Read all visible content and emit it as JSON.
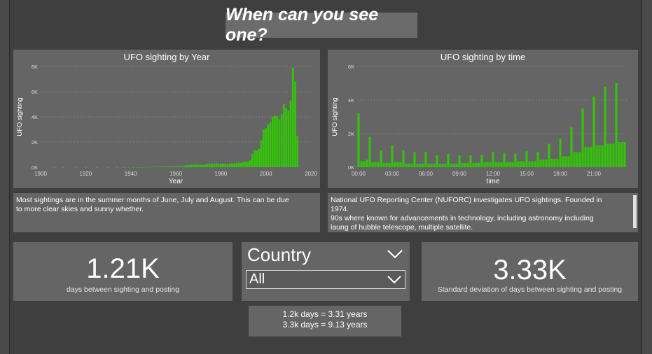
{
  "header": {
    "title": "When can you see one?"
  },
  "chart_year": {
    "title": "UFO sighting by Year",
    "xlabel": "Year",
    "ylabel": "UFO sighting",
    "x_ticks": [
      "1900",
      "1920",
      "1940",
      "1960",
      "1980",
      "2000",
      "2020"
    ],
    "y_ticks": [
      "0K",
      "2K",
      "4K",
      "6K",
      "8K"
    ]
  },
  "chart_time": {
    "title": "UFO sighting by time",
    "xlabel": "time",
    "ylabel": "UFO sighting",
    "x_ticks": [
      "00:00",
      "03:00",
      "06:00",
      "09:00",
      "12:00",
      "15:00",
      "18:00",
      "21:00"
    ],
    "y_ticks": [
      "0K",
      "2K",
      "4K",
      "6K"
    ]
  },
  "notes": {
    "left_lines": [
      "Most sightings are in the summer months of June, July and August. This can be due",
      "to more clear skies and sunny whether."
    ],
    "right_lines": [
      "National UFO Reporting Center (NUFORC) investigates UFO sightings. Founded in",
      "1974.",
      "90s where known for advancements in technology, including astronomy including",
      "laung of hubble telescope, multiple satellite."
    ]
  },
  "kpi_left": {
    "value": "1.21K",
    "label": "days between sighting and posting"
  },
  "kpi_right": {
    "value": "3.33K",
    "label": "Standard deviation of days between sighting and posting"
  },
  "slicer": {
    "title": "Country",
    "selected": "All"
  },
  "conversion": {
    "line1": "1.2k days = 3.31 years",
    "line2": "3.3k days = 9.13 years"
  },
  "colors": {
    "bar": "#33c40a",
    "canvas": "#3f3f3f",
    "panel": "#656565"
  },
  "chart_data": [
    {
      "type": "bar",
      "title": "UFO sighting by Year",
      "xlabel": "Year",
      "ylabel": "UFO sighting",
      "xlim": [
        1900,
        2020
      ],
      "ylim": [
        0,
        8000
      ],
      "x": [
        1906,
        1910,
        1916,
        1920,
        1925,
        1930,
        1934,
        1937,
        1939,
        1941,
        1943,
        1944,
        1945,
        1946,
        1947,
        1948,
        1949,
        1950,
        1951,
        1952,
        1953,
        1954,
        1955,
        1956,
        1957,
        1958,
        1959,
        1960,
        1961,
        1962,
        1963,
        1964,
        1965,
        1966,
        1967,
        1968,
        1969,
        1970,
        1971,
        1972,
        1973,
        1974,
        1975,
        1976,
        1977,
        1978,
        1979,
        1980,
        1981,
        1982,
        1983,
        1984,
        1985,
        1986,
        1987,
        1988,
        1989,
        1990,
        1991,
        1992,
        1993,
        1994,
        1995,
        1996,
        1997,
        1998,
        1999,
        2000,
        2001,
        2002,
        2003,
        2004,
        2005,
        2006,
        2007,
        2008,
        2009,
        2010,
        2011,
        2012,
        2013,
        2014
      ],
      "values": [
        1,
        1,
        1,
        1,
        2,
        2,
        2,
        2,
        3,
        4,
        5,
        6,
        8,
        15,
        40,
        20,
        25,
        30,
        25,
        45,
        45,
        55,
        60,
        60,
        75,
        70,
        70,
        80,
        70,
        80,
        90,
        120,
        170,
        160,
        200,
        180,
        200,
        180,
        180,
        180,
        210,
        260,
        290,
        280,
        270,
        310,
        280,
        280,
        270,
        280,
        260,
        280,
        300,
        300,
        330,
        360,
        340,
        400,
        440,
        440,
        550,
        1050,
        1360,
        1320,
        1460,
        2150,
        3000,
        3100,
        3360,
        3550,
        4000,
        4100,
        4050,
        3800,
        4200,
        5000,
        4700,
        4500,
        5300,
        7900,
        6800,
        2500
      ]
    },
    {
      "type": "bar",
      "title": "UFO sighting by time",
      "xlabel": "time",
      "ylabel": "UFO sighting",
      "ylim": [
        0,
        6000
      ],
      "x_unit": "minutes since 00:00",
      "x": [
        0,
        15,
        30,
        45,
        60,
        75,
        90,
        105,
        120,
        135,
        150,
        165,
        180,
        195,
        210,
        225,
        240,
        255,
        270,
        285,
        300,
        315,
        330,
        345,
        360,
        375,
        390,
        405,
        420,
        435,
        450,
        465,
        480,
        495,
        510,
        525,
        540,
        555,
        570,
        585,
        600,
        615,
        630,
        645,
        660,
        675,
        690,
        705,
        720,
        735,
        750,
        765,
        780,
        795,
        810,
        825,
        840,
        855,
        870,
        885,
        900,
        915,
        930,
        945,
        960,
        975,
        990,
        1005,
        1020,
        1035,
        1050,
        1065,
        1080,
        1095,
        1110,
        1125,
        1140,
        1155,
        1170,
        1185,
        1200,
        1215,
        1230,
        1245,
        1260,
        1275,
        1290,
        1305,
        1320,
        1335,
        1350,
        1365,
        1380,
        1395,
        1410,
        1425
      ],
      "values": [
        3200,
        350,
        350,
        450,
        1800,
        300,
        300,
        300,
        1000,
        250,
        250,
        250,
        1300,
        300,
        300,
        300,
        1000,
        200,
        200,
        200,
        900,
        200,
        200,
        200,
        900,
        200,
        200,
        200,
        700,
        200,
        200,
        200,
        800,
        200,
        200,
        200,
        700,
        250,
        250,
        250,
        700,
        250,
        250,
        250,
        750,
        300,
        300,
        300,
        900,
        300,
        300,
        300,
        850,
        300,
        300,
        300,
        800,
        350,
        350,
        350,
        950,
        350,
        350,
        350,
        900,
        450,
        450,
        450,
        1400,
        500,
        500,
        500,
        1700,
        650,
        650,
        650,
        2400,
        900,
        900,
        900,
        3500,
        1200,
        1200,
        1200,
        4200,
        1300,
        1300,
        1300,
        4800,
        1400,
        1400,
        1400,
        5000,
        1500,
        1500,
        1500,
        3800,
        1200,
        1200,
        1200,
        1400,
        800,
        800,
        800
      ]
    }
  ]
}
